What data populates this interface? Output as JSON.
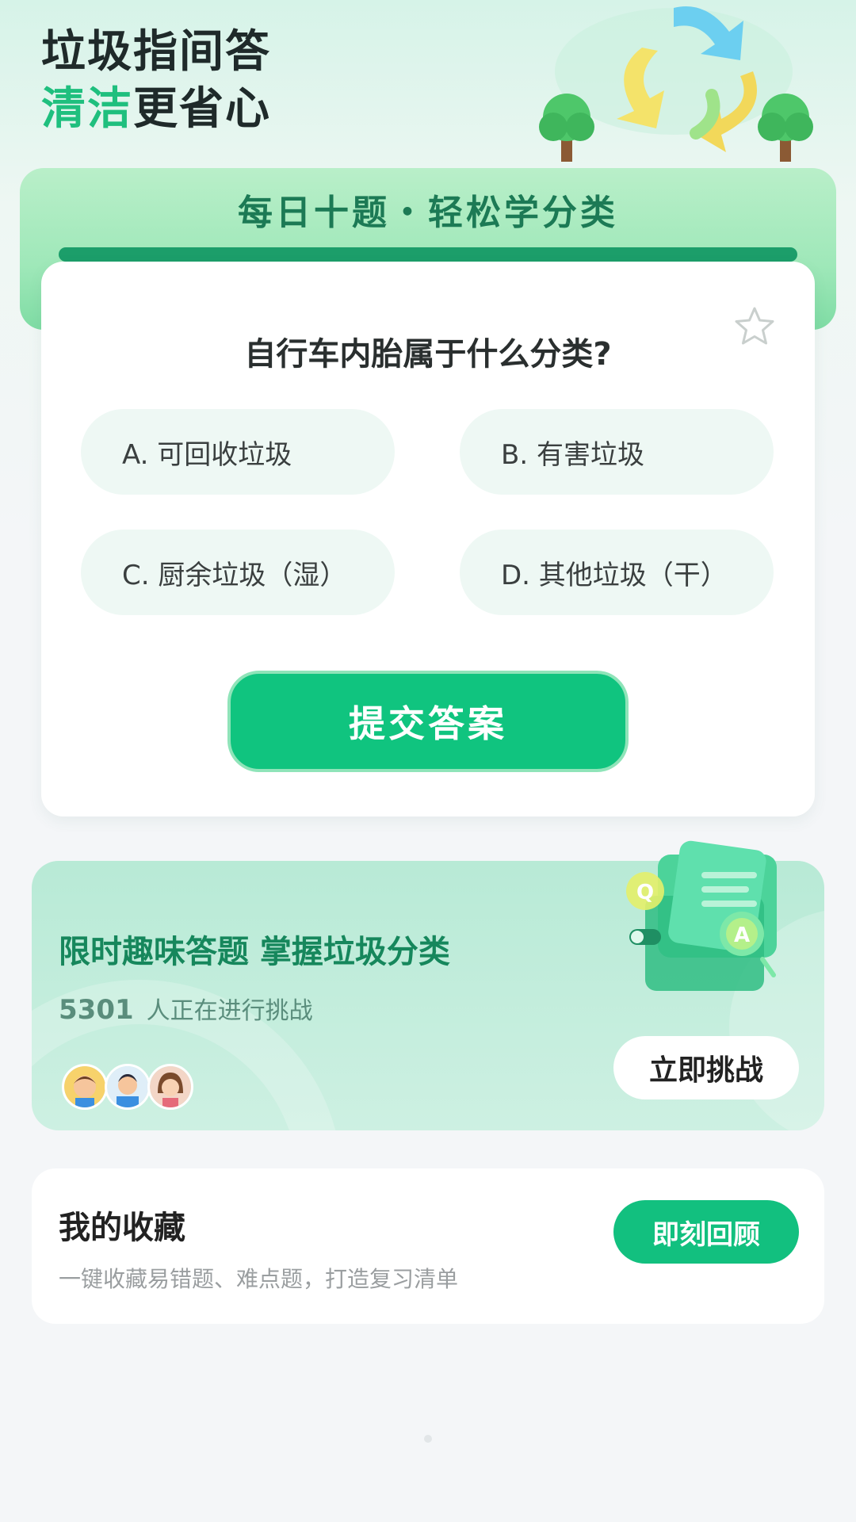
{
  "header": {
    "title_line1": "垃圾指间答",
    "title_line2_accent": "清洁",
    "title_line2_rest": "更省心"
  },
  "quiz": {
    "banner_title": "每日十题・轻松学分类",
    "question": "自行车内胎属于什么分类?",
    "options": [
      {
        "label": "A. 可回收垃圾"
      },
      {
        "label": "B. 有害垃圾"
      },
      {
        "label": "C. 厨余垃圾（湿）"
      },
      {
        "label": "D. 其他垃圾（干）"
      }
    ],
    "submit_label": "提交答案",
    "favorite_icon": "star-outline-icon"
  },
  "challenge": {
    "title": "限时趣味答题 掌握垃圾分类",
    "count": "5301",
    "count_suffix": "人正在进行挑战",
    "button_label": "立即挑战"
  },
  "favorites": {
    "title": "我的收藏",
    "subtitle": "一键收藏易错题、难点题，打造复习清单",
    "button_label": "即刻回顾"
  },
  "colors": {
    "accent": "#1fbf7e",
    "primary_button": "#10c47f",
    "banner_text": "#1c7a55"
  }
}
